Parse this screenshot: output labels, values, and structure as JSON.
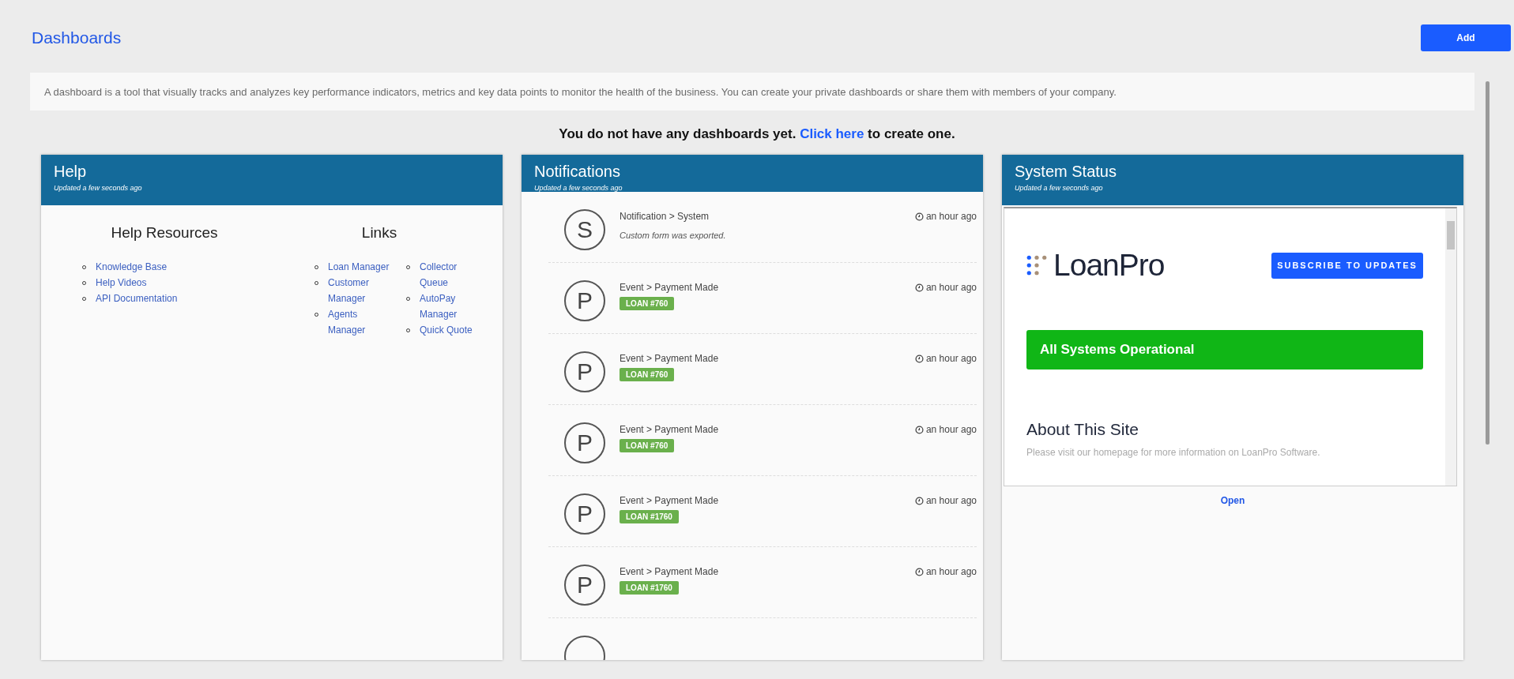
{
  "page": {
    "title": "Dashboards",
    "add_button": "Add",
    "description": "A dashboard is a tool that visually tracks and analyzes key performance indicators, metrics and key data points to monitor the health of the business. You can create your private dashboards or share them with members of your company.",
    "empty_message": {
      "before": "You do not have any dashboards yet.",
      "link": "Click here",
      "after": "to create one."
    }
  },
  "help_card": {
    "title": "Help",
    "updated": "Updated a few seconds ago",
    "resources_heading": "Help Resources",
    "resources": [
      "Knowledge Base",
      "Help Videos",
      "API Documentation"
    ],
    "links_heading": "Links",
    "links_columns": [
      [
        "Loan Manager",
        "Customer Manager",
        "Agents Manager"
      ],
      [
        "Collector Queue",
        "AutoPay Manager",
        "Quick Quote"
      ]
    ]
  },
  "notifications_card": {
    "title": "Notifications",
    "updated": "Updated a few seconds ago",
    "items": [
      {
        "kind": "message",
        "letter": "S",
        "title": "Notification > System",
        "time": "an hour ago",
        "text": "Custom form was exported."
      },
      {
        "kind": "badge",
        "letter": "P",
        "title": "Event > Payment Made",
        "time": "an hour ago",
        "text": "LOAN #760"
      },
      {
        "kind": "badge",
        "letter": "P",
        "title": "Event > Payment Made",
        "time": "an hour ago",
        "text": "LOAN #760"
      },
      {
        "kind": "badge",
        "letter": "P",
        "title": "Event > Payment Made",
        "time": "an hour ago",
        "text": "LOAN #760"
      },
      {
        "kind": "badge",
        "letter": "P",
        "title": "Event > Payment Made",
        "time": "an hour ago",
        "text": "LOAN #1760"
      },
      {
        "kind": "badge",
        "letter": "P",
        "title": "Event > Payment Made",
        "time": "an hour ago",
        "text": "LOAN #1760"
      }
    ]
  },
  "status_card": {
    "title": "System Status",
    "updated": "Updated a few seconds ago",
    "logo": "LoanPro",
    "subscribe_button": "SUBSCRIBE TO UPDATES",
    "status": "All Systems Operational",
    "about_heading": "About This Site",
    "about_text": "Please visit our homepage for more information on LoanPro Software.",
    "open_link": "Open"
  }
}
